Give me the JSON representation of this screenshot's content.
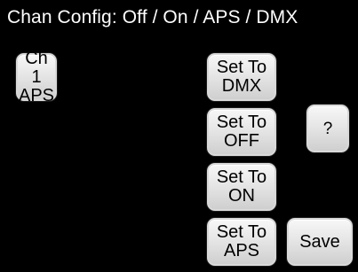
{
  "screen": {
    "title": "Chan Config: Off / On / APS / DMX"
  },
  "channel_button": {
    "line1": "Ch 1",
    "line2": "APS"
  },
  "set_dmx_button": {
    "line1": "Set To",
    "line2": "DMX"
  },
  "set_off_button": {
    "line1": "Set To",
    "line2": "OFF"
  },
  "set_on_button": {
    "line1": "Set To",
    "line2": "ON"
  },
  "set_aps_button": {
    "line1": "Set To",
    "line2": "APS"
  },
  "help_button": {
    "label": "?"
  },
  "save_button": {
    "label": "Save"
  }
}
